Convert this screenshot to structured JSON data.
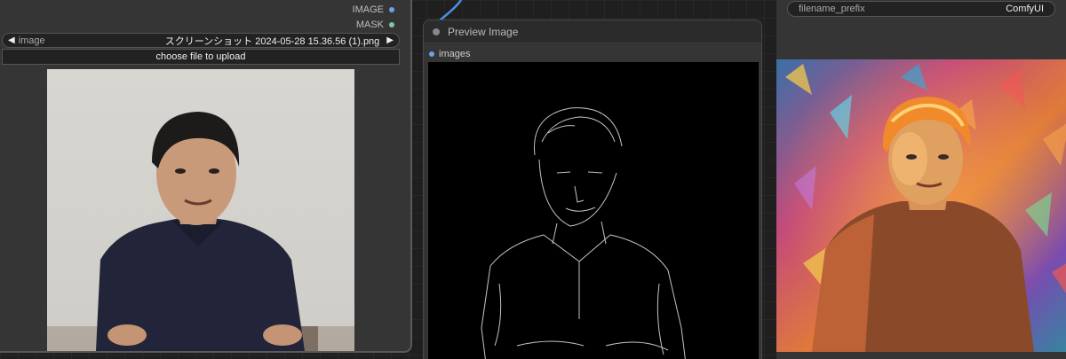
{
  "load_image_node": {
    "outputs": [
      {
        "label": "IMAGE",
        "color": "#6ea0e8"
      },
      {
        "label": "MASK",
        "color": "#7ec8a0"
      }
    ],
    "image_widget": {
      "label": "image",
      "value": "スクリーンショット 2024-05-28 15.36.56 (1).png",
      "left_arrow": "◀",
      "right_arrow": "▶"
    },
    "upload_button": "choose file to upload"
  },
  "preview_node": {
    "title": "Preview Image",
    "input_label": "images",
    "input_color": "#6ea0e8"
  },
  "save_node": {
    "widget_label": "filename_prefix",
    "widget_value": "ComfyUI"
  },
  "colors": {
    "canvas_bg": "#1f1f1f",
    "node_bg": "#353535",
    "link_color": "#4a90e2"
  }
}
